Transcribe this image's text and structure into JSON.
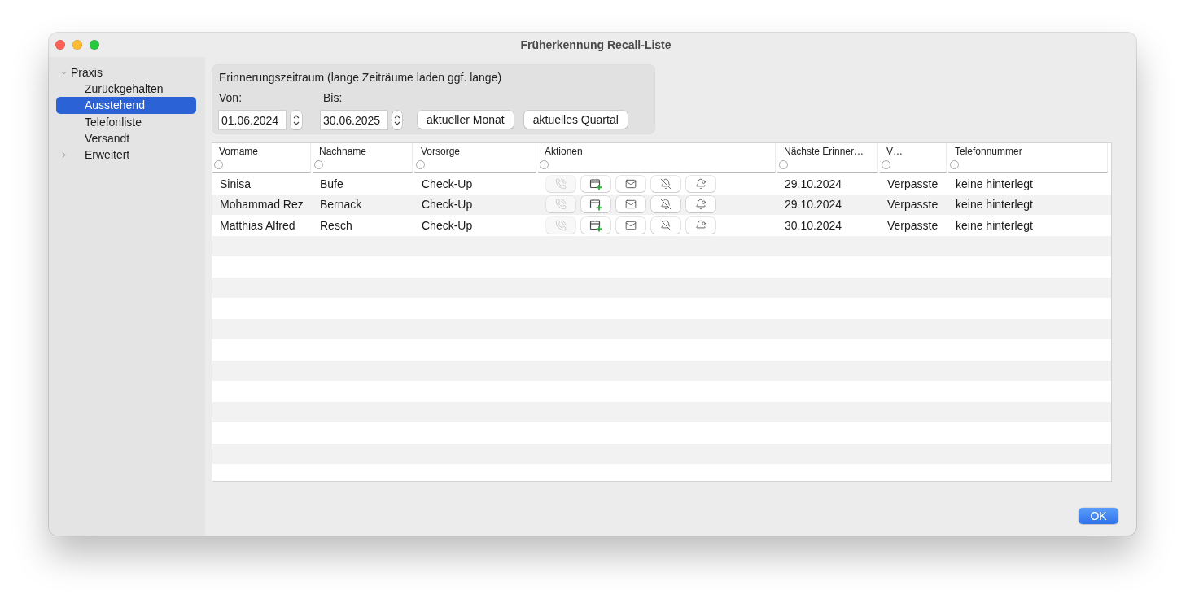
{
  "window": {
    "title": "Früherkennung Recall-Liste"
  },
  "sidebar": {
    "items": [
      {
        "label": "Praxis",
        "expanded": true,
        "selected": false,
        "children": [
          {
            "label": "Zurückgehalten",
            "selected": false
          },
          {
            "label": "Ausstehend",
            "selected": true
          },
          {
            "label": "Telefonliste",
            "selected": false
          },
          {
            "label": "Versandt",
            "selected": false
          },
          {
            "label": "Erweitert",
            "selected": false,
            "expanded": false
          }
        ]
      }
    ]
  },
  "period": {
    "title": "Erinnerungszeitraum (lange Zeiträume laden ggf. lange)",
    "from": {
      "label": "Von:",
      "value": "01.06.2024"
    },
    "to": {
      "label": "Bis:",
      "value": "30.06.2025"
    },
    "buttons": [
      "aktueller Monat",
      "aktuelles Quartal"
    ]
  },
  "table": {
    "columns": [
      {
        "label": "Vorname",
        "kind": "text"
      },
      {
        "label": "Nachname",
        "kind": "text"
      },
      {
        "label": "Vorsorge",
        "kind": "text"
      },
      {
        "label": "Aktionen",
        "kind": "actions"
      },
      {
        "label": "Nächste Erinner…",
        "kind": "text"
      },
      {
        "label": "V…",
        "kind": "text"
      },
      {
        "label": "Telefonnummer",
        "kind": "text"
      }
    ],
    "rows": [
      {
        "cells": [
          "Sinisa",
          "Bufe",
          "Check-Up",
          {
            "actions": [
              {
                "kind": "call",
                "disabled": true
              },
              {
                "kind": "appointment",
                "disabled": false
              },
              {
                "kind": "mail",
                "disabled": false
              },
              {
                "kind": "mute",
                "disabled": false
              },
              {
                "kind": "remind",
                "disabled": false
              }
            ]
          },
          "29.10.2024",
          "Verpasste",
          "keine hinterlegt"
        ]
      },
      {
        "cells": [
          "Mohammad Rez",
          "Bernack",
          "Check-Up",
          {
            "actions": [
              {
                "kind": "call",
                "disabled": true
              },
              {
                "kind": "appointment",
                "disabled": false
              },
              {
                "kind": "mail",
                "disabled": false
              },
              {
                "kind": "mute",
                "disabled": false
              },
              {
                "kind": "remind",
                "disabled": false
              }
            ]
          },
          "29.10.2024",
          "Verpasste",
          "keine hinterlegt"
        ]
      },
      {
        "cells": [
          "Matthias Alfred",
          "Resch",
          "Check-Up",
          {
            "actions": [
              {
                "kind": "call",
                "disabled": true
              },
              {
                "kind": "appointment",
                "disabled": false
              },
              {
                "kind": "mail",
                "disabled": false
              },
              {
                "kind": "mute",
                "disabled": false
              },
              {
                "kind": "remind",
                "disabled": false
              }
            ]
          },
          "30.10.2024",
          "Verpasste",
          "keine hinterlegt"
        ]
      }
    ]
  },
  "buttons": [
    "OK"
  ]
}
